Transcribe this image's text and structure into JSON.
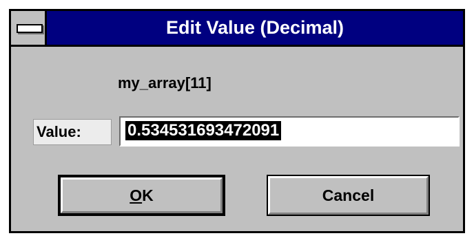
{
  "dialog": {
    "title": "Edit Value (Decimal)",
    "item_name": "my_array[11]",
    "value_label": "Value:",
    "value": "0.534531693472091",
    "ok_mnemonic": "O",
    "ok_rest": "K",
    "cancel_label": "Cancel"
  },
  "colors": {
    "titlebar": "#000080",
    "face": "#c0c0c0",
    "selection": "#000000"
  },
  "icons": {
    "system_menu": "system-menu-icon"
  }
}
